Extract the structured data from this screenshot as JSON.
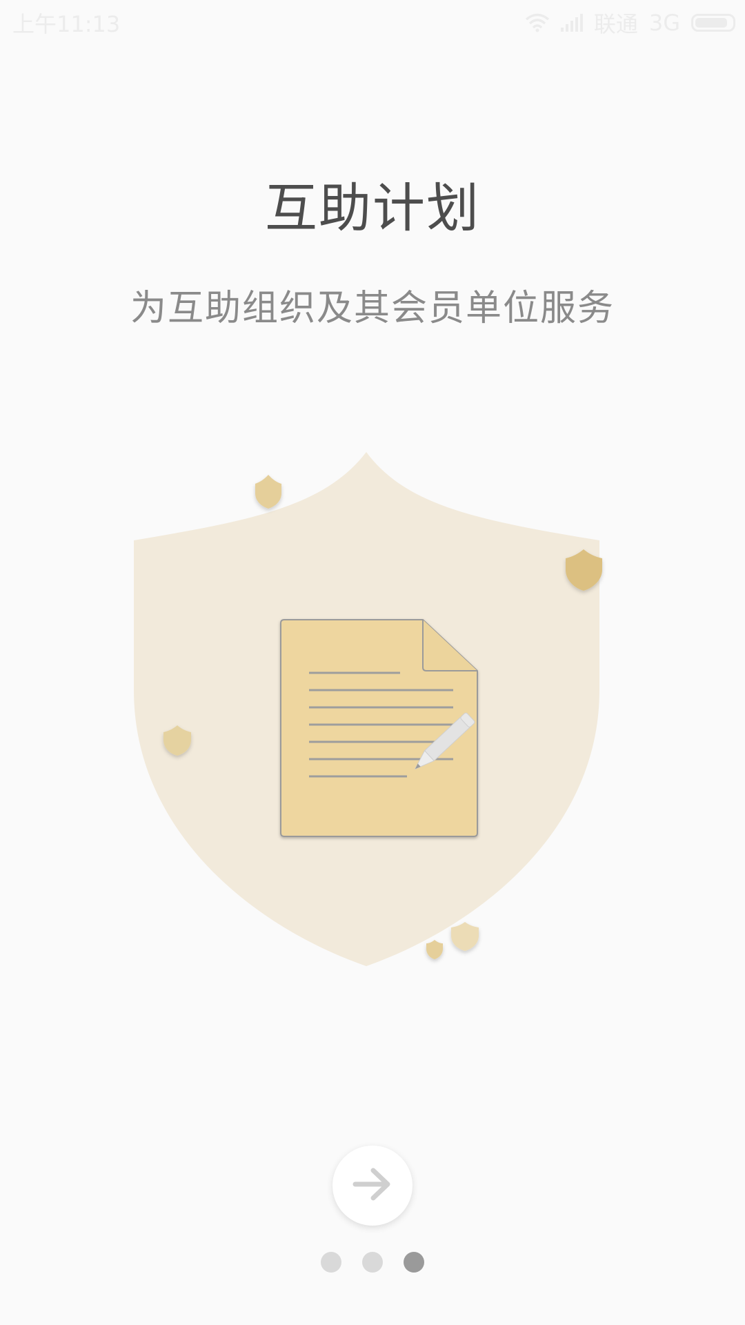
{
  "status_bar": {
    "time": "上午11:13",
    "carrier": "联通",
    "network": "3G",
    "battery_level": 0.9,
    "icons": [
      "wifi-icon",
      "signal-icon",
      "battery-icon"
    ],
    "color": "#ececec"
  },
  "intro": {
    "title": "互助计划",
    "subtitle": "为互助组织及其会员单位服务"
  },
  "illustration": {
    "icons": [
      "large-shield-icon",
      "document-icon",
      "pencil-icon",
      "small-shield-icon"
    ],
    "colors": {
      "shield": "#f2eadb",
      "document": "#eed69f",
      "small_shield": "#e5cf9a",
      "lines": "#999999"
    }
  },
  "navigation": {
    "next_icon": "arrow-right-icon",
    "pages": [
      {
        "active": false
      },
      {
        "active": false
      },
      {
        "active": true
      }
    ],
    "current_page": 3,
    "total_pages": 3
  }
}
